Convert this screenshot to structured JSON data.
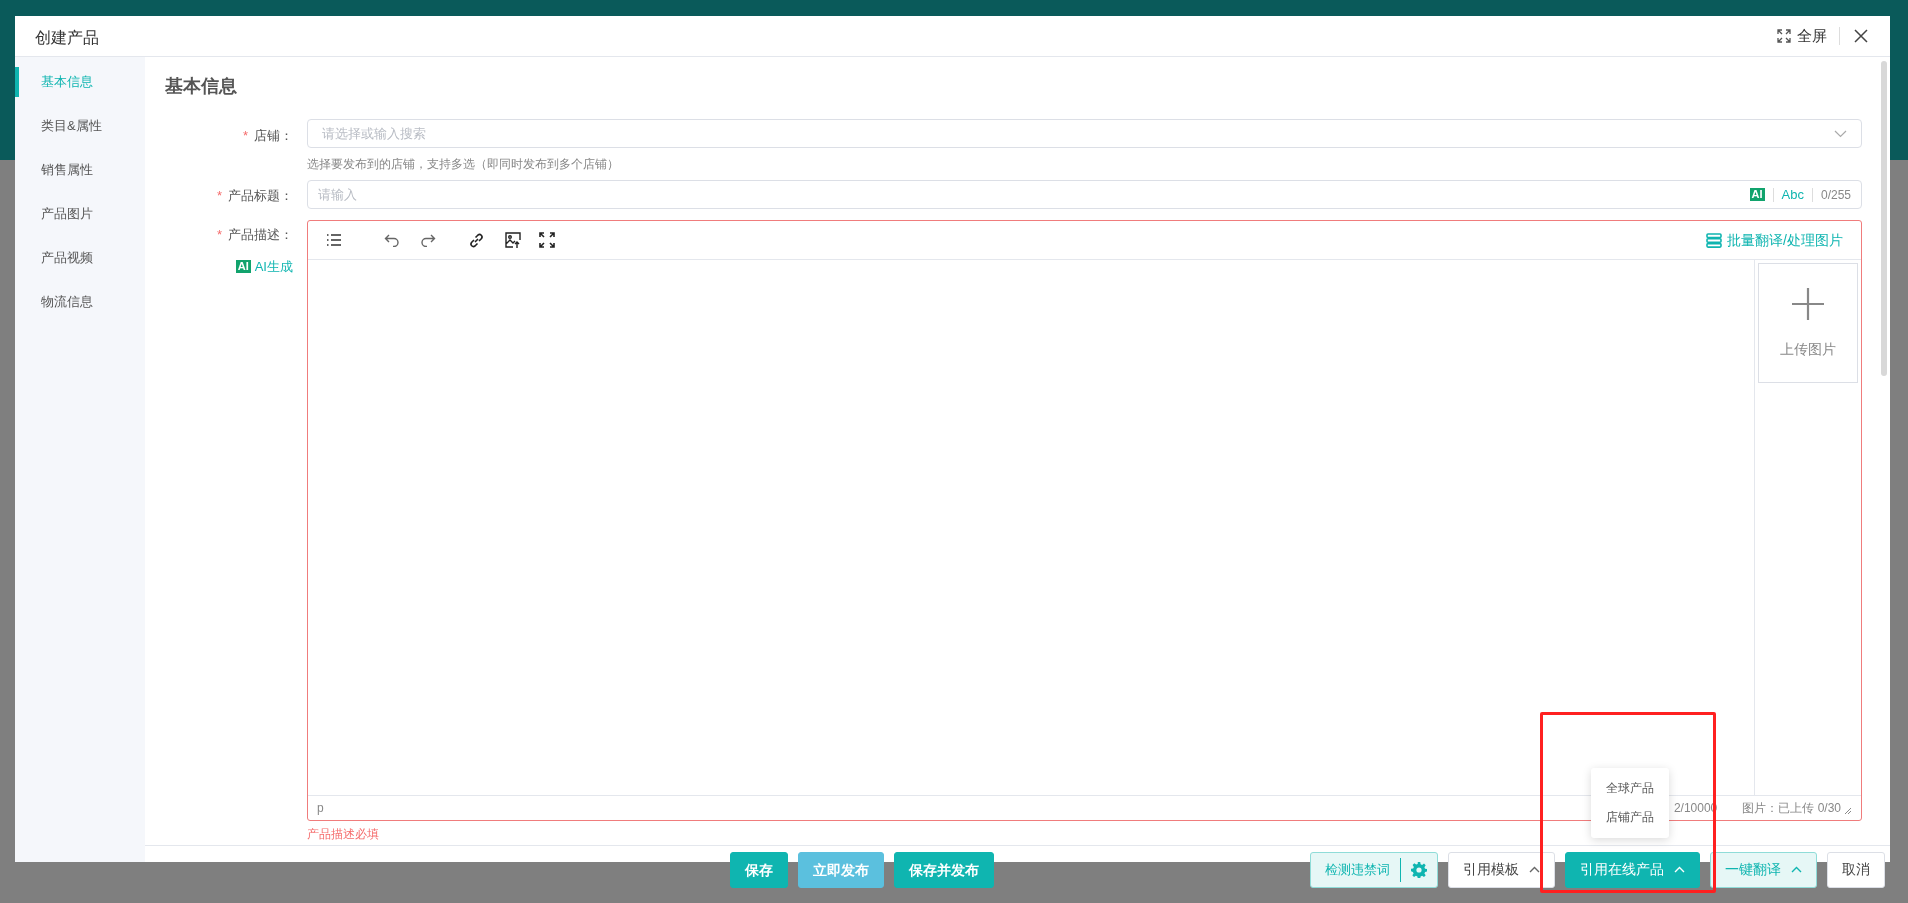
{
  "modal": {
    "title": "创建产品",
    "fullscreen_label": "全屏"
  },
  "sidebar": {
    "items": [
      {
        "label": "基本信息",
        "selected": true
      },
      {
        "label": "类目&属性",
        "selected": false
      },
      {
        "label": "销售属性",
        "selected": false
      },
      {
        "label": "产品图片",
        "selected": false
      },
      {
        "label": "产品视频",
        "selected": false
      },
      {
        "label": "物流信息",
        "selected": false
      }
    ]
  },
  "section_title": "基本信息",
  "form": {
    "store": {
      "label": "店铺：",
      "required_mark": "*",
      "placeholder": "请选择或输入搜索",
      "help": "选择要发布到的店铺，支持多选（即同时发布到多个店铺）"
    },
    "title": {
      "label": "产品标题：",
      "required_mark": "*",
      "placeholder": "请输入",
      "ai_badge": "AI",
      "translate": "Abc",
      "counter": "0/255"
    },
    "description": {
      "label": "产品描述：",
      "required_mark": "*",
      "ai_badge": "AI",
      "ai_link": "AI生成",
      "batch_action": "批量翻译/处理图片",
      "upload_label": "上传图片",
      "path": "p",
      "char_count": "2/10000",
      "image_count": "图片：已上传 0/30",
      "error": "产品描述必填"
    }
  },
  "footer": {
    "left_buttons": [
      {
        "label": "保存",
        "kind": "primary"
      },
      {
        "label": "立即发布",
        "kind": "info"
      },
      {
        "label": "保存并发布",
        "kind": "primary"
      }
    ],
    "right_buttons": [
      {
        "label": "检测违禁词",
        "kind": "check"
      },
      {
        "label": "引用模板",
        "kind": "outline",
        "caret": true
      },
      {
        "label": "引用在线产品",
        "kind": "primary",
        "caret": true,
        "expanded": true,
        "menu": [
          "全球产品",
          "店铺产品"
        ]
      },
      {
        "label": "一键翻译",
        "kind": "light",
        "caret": true
      },
      {
        "label": "取消",
        "kind": "outline",
        "caret": false
      }
    ]
  }
}
